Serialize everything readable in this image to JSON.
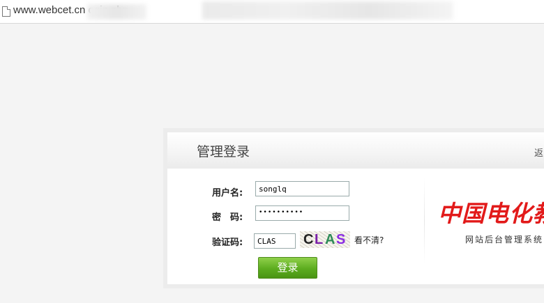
{
  "browser": {
    "url": "www.webcet.cn          ogin.php"
  },
  "login": {
    "title": "管理登录",
    "back_link": "返",
    "username_label": "用户名:",
    "username_value": "songlq",
    "password_label": "密　码:",
    "password_value": "••••••••••",
    "captcha_label": "验证码:",
    "captcha_value": "CLAS",
    "captcha_image_text": [
      "C",
      "L",
      "A",
      "S"
    ],
    "captcha_colors": [
      "#222222",
      "#7a1fa8",
      "#2e8b57",
      "#8a2be2"
    ],
    "refresh_captcha": "看不清?",
    "submit_label": "登录"
  },
  "brand": {
    "logo_text": "中国电化教",
    "subtitle": "网站后台管理系统",
    "logo_color": "#e21a1a"
  },
  "colors": {
    "button_green": "#5cac1f",
    "background": "#f4f4f4"
  }
}
